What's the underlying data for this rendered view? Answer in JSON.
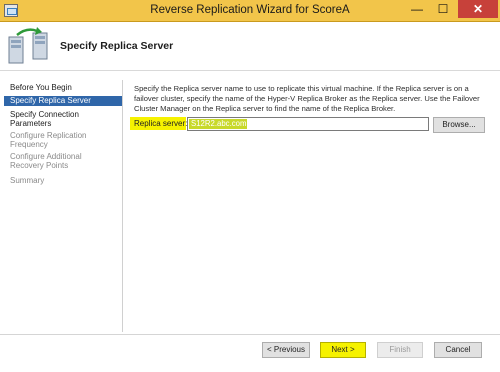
{
  "window": {
    "title": "Reverse Replication Wizard for ScoreA",
    "min_glyph": "—",
    "max_glyph": "☐",
    "close_glyph": "✕"
  },
  "header": {
    "page_title": "Specify Replica Server"
  },
  "nav": {
    "items": [
      {
        "label": "Before You Begin",
        "state": "normal"
      },
      {
        "label": "Specify Replica Server",
        "state": "selected"
      },
      {
        "label": "Specify Connection Parameters",
        "state": "normal"
      },
      {
        "label": "Configure Replication Frequency",
        "state": "disabled"
      },
      {
        "label": "Configure Additional Recovery Points",
        "state": "disabled"
      },
      {
        "label": "Summary",
        "state": "disabled"
      }
    ]
  },
  "main": {
    "description": "Specify the Replica server name to use to replicate this virtual machine. If the Replica server is on a failover cluster, specify the name of the Hyper-V Replica Broker as the Replica server. Use the Failover Cluster Manager on the Replica server to find the name of the Replica Broker.",
    "replica_server_label": "Replica server:",
    "replica_server_value": "S12R2.abc.com",
    "browse_label": "Browse..."
  },
  "footer": {
    "previous_label": "< Previous",
    "next_label": "Next >",
    "finish_label": "Finish",
    "cancel_label": "Cancel"
  },
  "colors": {
    "titlebar": "#f2c54a",
    "selected_nav": "#2f66a9",
    "highlight": "#f6f200",
    "close_button": "#c7413a"
  }
}
